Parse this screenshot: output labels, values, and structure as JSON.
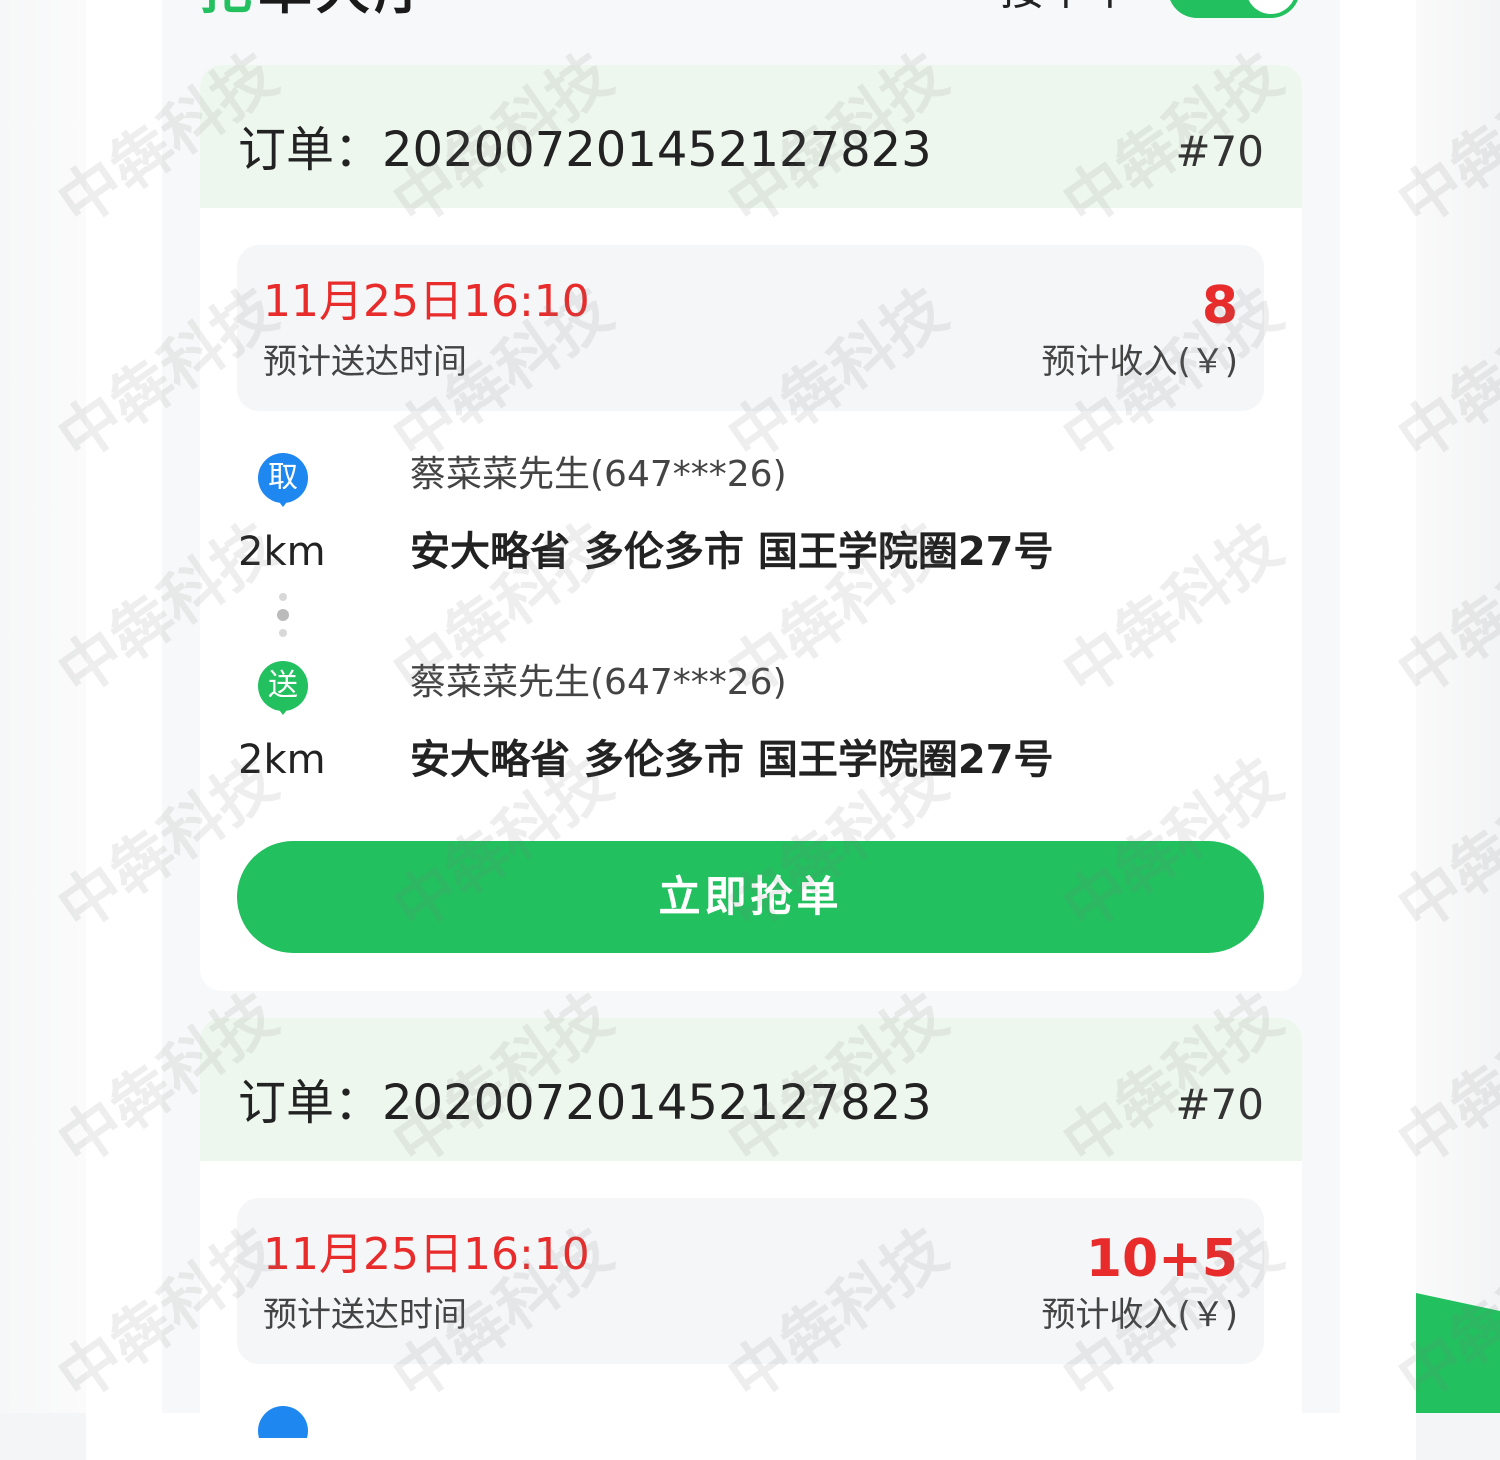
{
  "header": {
    "title_green": "抢",
    "title_rest": "单大厅",
    "status_label": "接单中"
  },
  "orders": [
    {
      "order_label": "订单：",
      "order_no": "202007201452127823",
      "tag": "#70",
      "deliver_time": "11月25日16:10",
      "deliver_label": "预计送达时间",
      "income": "8",
      "income_label": "预计收入(￥)",
      "pickup": {
        "icon_text": "取",
        "distance": "2km",
        "contact": "蔡菜菜先生(647***26)",
        "address": "安大略省 多伦多市 国王学院圈27号"
      },
      "dropoff": {
        "icon_text": "送",
        "distance": "2km",
        "contact": "蔡菜菜先生(647***26)",
        "address": "安大略省 多伦多市 国王学院圈27号"
      },
      "button_label": "立即抢单"
    },
    {
      "order_label": "订单：",
      "order_no": "202007201452127823",
      "tag": "#70",
      "deliver_time": "11月25日16:10",
      "deliver_label": "预计送达时间",
      "income": "10+5",
      "income_label": "预计收入(￥)"
    }
  ],
  "watermark": "中犇科技",
  "colors": {
    "accent_green": "#22c05f",
    "price_red": "#e82b2b",
    "pickup_blue": "#1f87f0",
    "header_bg": "#eef7ee"
  }
}
